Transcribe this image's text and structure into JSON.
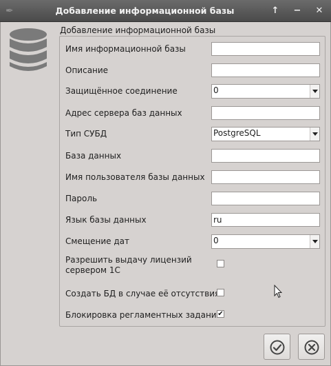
{
  "window": {
    "title": "Добавление информационной базы"
  },
  "titlebar_buttons": {
    "up_label": "↑",
    "minimize_label": "−",
    "close_label": "✕"
  },
  "group": {
    "title": "Добавление информационной базы"
  },
  "fields": [
    {
      "label": "Имя информационной базы",
      "value": ""
    },
    {
      "label": "Описание",
      "value": ""
    },
    {
      "label": "Защищённое соединение",
      "value": "0"
    },
    {
      "label": "Адрес сервера баз данных",
      "value": ""
    },
    {
      "label": "Тип СУБД",
      "value": "PostgreSQL"
    },
    {
      "label": "База данных",
      "value": ""
    },
    {
      "label": "Имя пользователя базы данных",
      "value": ""
    },
    {
      "label": "Пароль",
      "value": ""
    },
    {
      "label": "Язык базы данных",
      "value": "ru"
    },
    {
      "label": "Смещение дат",
      "value": "0"
    }
  ],
  "checkboxes": [
    {
      "label": "Разрешить выдачу лицензий сервером 1С",
      "checked": false
    },
    {
      "label": "Создать БД в случае её отсутствия",
      "checked": false
    },
    {
      "label": "Блокировка регламентных заданий",
      "checked": true,
      "mark": "✔"
    }
  ],
  "icons": {
    "app": "feather-icon",
    "database": "database-icon",
    "ok": "check-circle-icon",
    "cancel": "cancel-circle-icon"
  },
  "colors": {
    "titlebar": "#555555",
    "window_bg": "#d6d2d0",
    "field_bg": "#ffffff",
    "icon_gray": "#7a7a7a"
  }
}
